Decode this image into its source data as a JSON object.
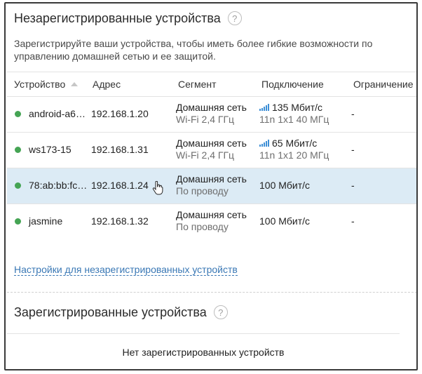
{
  "unregistered": {
    "title": "Незарегистрированные устройства",
    "help": "?",
    "description": "Зарегистрируйте ваши устройства, чтобы иметь более гибкие возможности по управлению  домашней сетью и ее защитой.",
    "columns": {
      "device": "Устройство",
      "address": "Адрес",
      "segment": "Сегмент",
      "connection": "Подключение",
      "limit": "Ограничение"
    },
    "rows": [
      {
        "device": "android-a6…",
        "ip": "192.168.1.20",
        "segment": "Домашняя сеть",
        "segment_sub": "Wi-Fi 2,4 ГГц",
        "speed": "135 Мбит/с",
        "conn_sub": "11n 1x1 40 МГц",
        "limit": "-",
        "status_color": "#45a454",
        "wifi": true
      },
      {
        "device": "ws173-15",
        "ip": "192.168.1.31",
        "segment": "Домашняя сеть",
        "segment_sub": "Wi-Fi 2,4 ГГц",
        "speed": "65 Мбит/с",
        "conn_sub": "11n 1x1 20 МГц",
        "limit": "-",
        "status_color": "#45a454",
        "wifi": true
      },
      {
        "device": "78:ab:bb:fc…",
        "ip": "192.168.1.24",
        "segment": "Домашняя сеть",
        "segment_sub": "По проводу",
        "speed": "100 Мбит/с",
        "conn_sub": "",
        "limit": "-",
        "status_color": "#45a454",
        "wifi": false
      },
      {
        "device": "jasmine",
        "ip": "192.168.1.32",
        "segment": "Домашняя сеть",
        "segment_sub": "По проводу",
        "speed": "100 Мбит/с",
        "conn_sub": "",
        "limit": "-",
        "status_color": "#45a454",
        "wifi": false
      }
    ],
    "settings_link": "Настройки для незарегистрированных устройств"
  },
  "registered": {
    "title": "Зарегистрированные устройства",
    "help": "?",
    "empty": "Нет зарегистрированных устройств"
  },
  "icons": [
    "help-icon",
    "sort-asc-icon",
    "status-dot-icon",
    "wifi-signal-icon",
    "hand-cursor-icon"
  ],
  "colors": {
    "accent_link": "#3a78b5",
    "status_online": "#45a454",
    "row_highlight": "#dcebf5",
    "signal": "#3d8fd6"
  }
}
